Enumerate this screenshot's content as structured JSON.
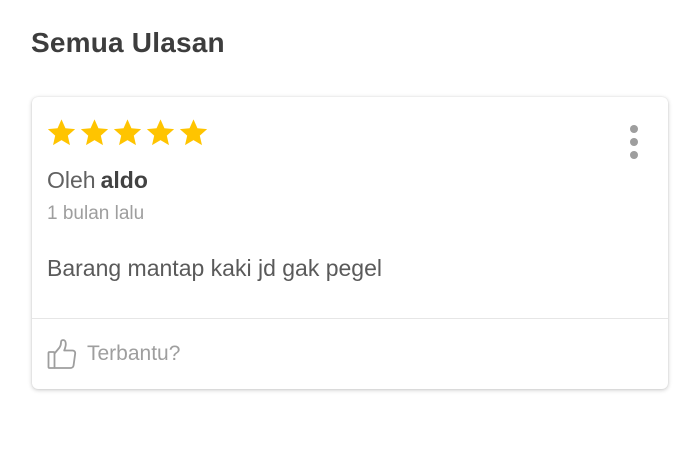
{
  "section": {
    "title": "Semua Ulasan"
  },
  "review": {
    "rating": 5,
    "rating_max": 5,
    "star_color": "#FFC400",
    "by_prefix": "Oleh",
    "author": "aldo",
    "time_ago": "1 bulan lalu",
    "text": "Barang mantap kaki jd gak pegel",
    "more_icon": "more-vertical-icon",
    "helpful_icon": "thumbs-up-icon",
    "helpful_label": "Terbantu?"
  }
}
